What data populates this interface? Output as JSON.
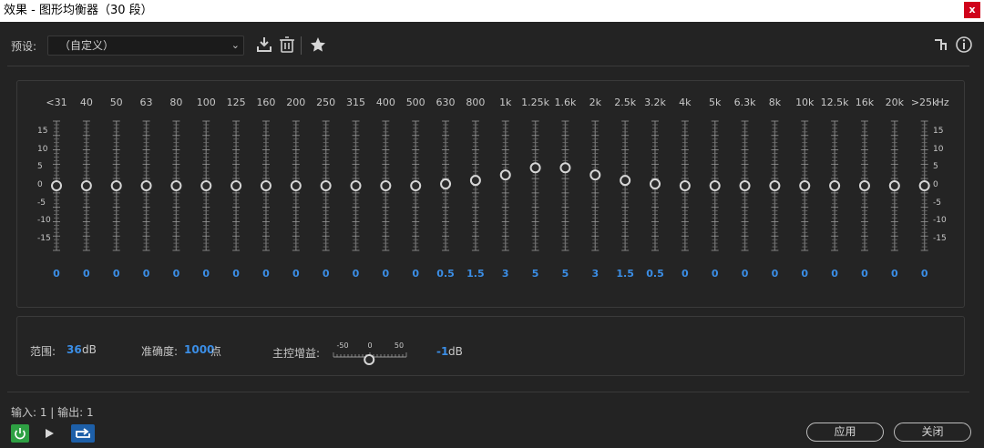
{
  "window": {
    "title": "效果 - 图形均衡器（30 段）",
    "close_label": "x"
  },
  "toolbar": {
    "preset_label": "预设:",
    "preset_value": "（自定义）"
  },
  "eq": {
    "bands": [
      {
        "freq": "<31",
        "gain": 0
      },
      {
        "freq": "40",
        "gain": 0
      },
      {
        "freq": "50",
        "gain": 0
      },
      {
        "freq": "63",
        "gain": 0
      },
      {
        "freq": "80",
        "gain": 0
      },
      {
        "freq": "100",
        "gain": 0
      },
      {
        "freq": "125",
        "gain": 0
      },
      {
        "freq": "160",
        "gain": 0
      },
      {
        "freq": "200",
        "gain": 0
      },
      {
        "freq": "250",
        "gain": 0
      },
      {
        "freq": "315",
        "gain": 0
      },
      {
        "freq": "400",
        "gain": 0
      },
      {
        "freq": "500",
        "gain": 0
      },
      {
        "freq": "630",
        "gain": 0.5
      },
      {
        "freq": "800",
        "gain": 1.5
      },
      {
        "freq": "1k",
        "gain": 3
      },
      {
        "freq": "1.25k",
        "gain": 5
      },
      {
        "freq": "1.6k",
        "gain": 5
      },
      {
        "freq": "2k",
        "gain": 3
      },
      {
        "freq": "2.5k",
        "gain": 1.5
      },
      {
        "freq": "3.2k",
        "gain": 0.5
      },
      {
        "freq": "4k",
        "gain": 0
      },
      {
        "freq": "5k",
        "gain": 0
      },
      {
        "freq": "6.3k",
        "gain": 0
      },
      {
        "freq": "8k",
        "gain": 0
      },
      {
        "freq": "10k",
        "gain": 0
      },
      {
        "freq": "12.5k",
        "gain": 0
      },
      {
        "freq": "16k",
        "gain": 0
      },
      {
        "freq": "20k",
        "gain": 0
      },
      {
        "freq": ">25k",
        "gain": 0
      }
    ],
    "hz_label": "Hz",
    "scale_left": [
      "15",
      "10",
      "5",
      "0",
      "-5",
      "-10",
      "-15"
    ],
    "scale_right": [
      "15",
      "10",
      "5",
      "0",
      "-5",
      "-10",
      "-15"
    ],
    "range": [
      -18,
      18
    ]
  },
  "settings": {
    "range_label": "范围:",
    "range_value": "36",
    "range_unit": "dB",
    "accuracy_label": "准确度:",
    "accuracy_value": "1000",
    "accuracy_unit": "点",
    "master_gain_label": "主控增益:",
    "master_gain_ticks": [
      "-50",
      "0",
      "50"
    ],
    "master_gain_value": "-1",
    "master_gain_unit": "dB",
    "master_gain_level": -1,
    "master_gain_range": [
      -50,
      50
    ]
  },
  "footer": {
    "io_text": "输入: 1 | 输出: 1",
    "apply_label": "应用",
    "close_label": "关闭"
  },
  "colors": {
    "accent": "#3b8ee6",
    "power_green": "#2ea043",
    "bg": "#232323"
  }
}
